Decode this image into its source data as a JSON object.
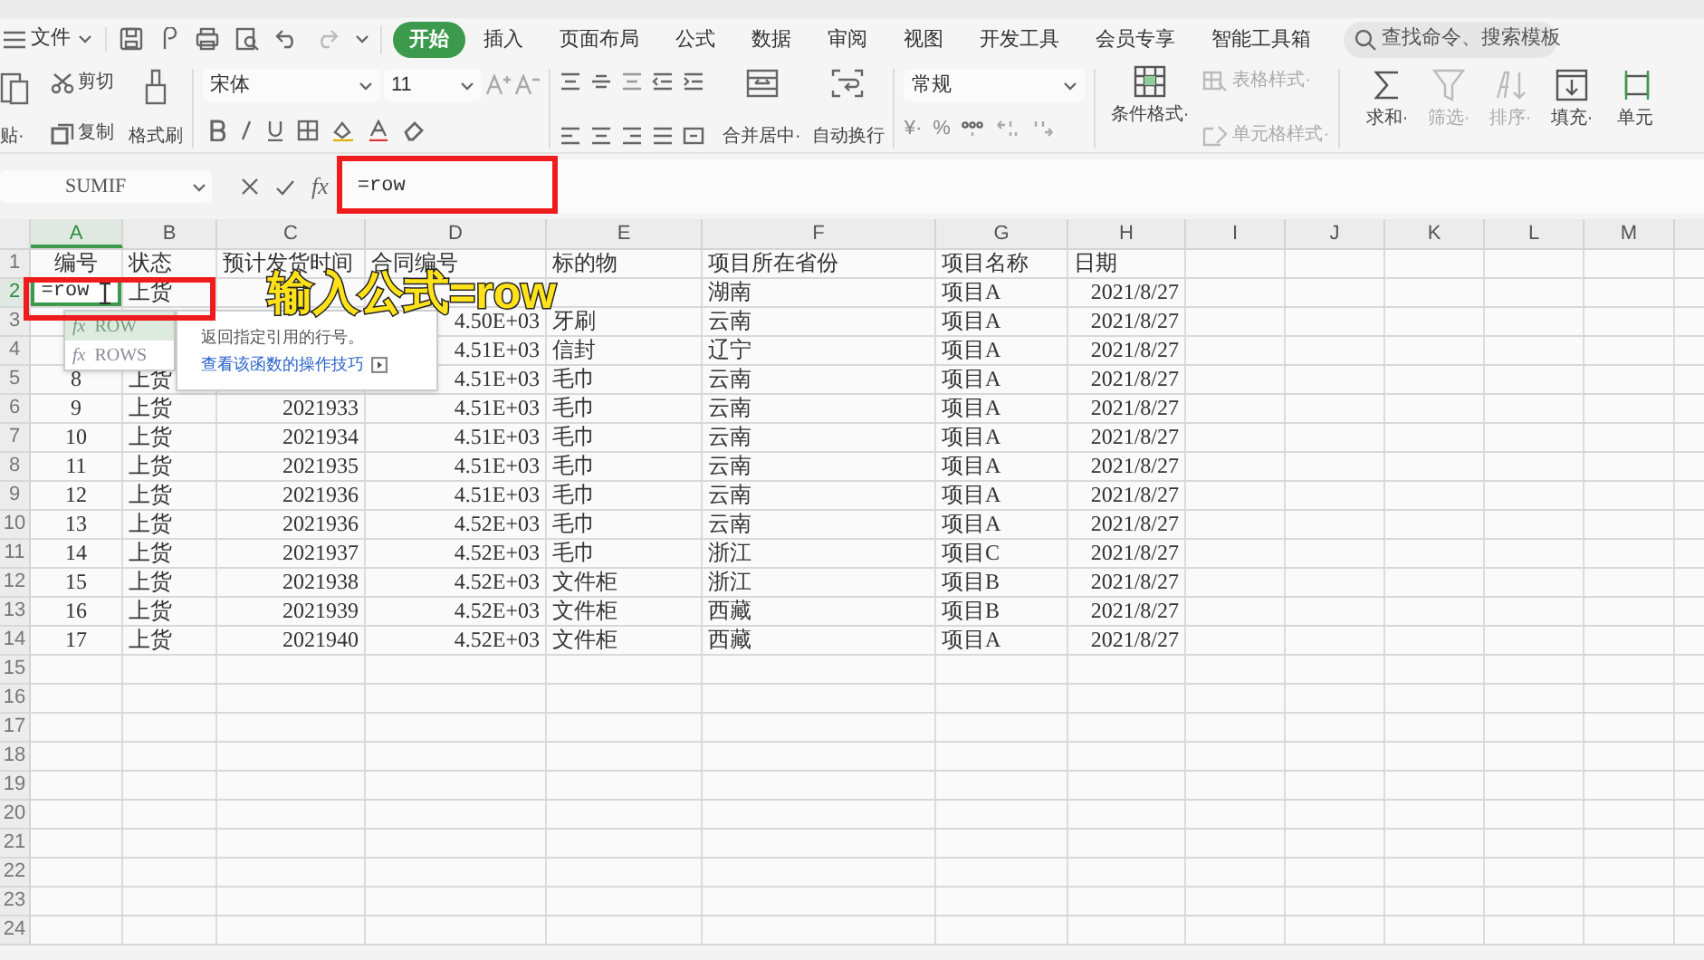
{
  "menu": {
    "file": "文件",
    "tabs": [
      {
        "label": "开始",
        "selected": true
      },
      {
        "label": "插入",
        "selected": false
      },
      {
        "label": "页面布局",
        "selected": false
      },
      {
        "label": "公式",
        "selected": false
      },
      {
        "label": "数据",
        "selected": false
      },
      {
        "label": "审阅",
        "selected": false
      },
      {
        "label": "视图",
        "selected": false
      },
      {
        "label": "开发工具",
        "selected": false
      },
      {
        "label": "会员专享",
        "selected": false
      },
      {
        "label": "智能工具箱",
        "selected": false
      }
    ],
    "search": {
      "placeholder": "查找命令、搜索模板"
    }
  },
  "ribbon": {
    "paste": "贴·",
    "cut": "剪切",
    "copy": "复制",
    "format_painter": "格式刷",
    "font": "宋体",
    "font_size": "11",
    "merge": "合并居中·",
    "wrap": "自动换行",
    "number_format": "常规",
    "currency": "¥·",
    "percent": "%",
    "styles": [
      {
        "kind": "conditional",
        "label": "条件格式·",
        "disabled": false
      },
      {
        "kind": "table-style",
        "label": "表格样式·",
        "disabled": true
      },
      {
        "kind": "cell-style",
        "label": "单元格样式·",
        "disabled": true
      }
    ],
    "editing": [
      {
        "kind": "sum",
        "label": "求和·",
        "disabled": false
      },
      {
        "kind": "filter",
        "label": "筛选·",
        "disabled": true
      },
      {
        "kind": "sort",
        "label": "排序·",
        "disabled": true
      },
      {
        "kind": "fill",
        "label": "填充·",
        "disabled": false
      },
      {
        "kind": "cell",
        "label": "单元",
        "disabled": false
      }
    ]
  },
  "formula_bar": {
    "name_box": "SUMIF",
    "fx": "fx",
    "value": "=row"
  },
  "sheet": {
    "columns": [
      {
        "letter": "A",
        "selected": true
      },
      {
        "letter": "B",
        "selected": false
      },
      {
        "letter": "C",
        "selected": false
      },
      {
        "letter": "D",
        "selected": false
      },
      {
        "letter": "E",
        "selected": false
      },
      {
        "letter": "F",
        "selected": false
      },
      {
        "letter": "G",
        "selected": false
      },
      {
        "letter": "H",
        "selected": false
      },
      {
        "letter": "I",
        "selected": false
      },
      {
        "letter": "J",
        "selected": false
      },
      {
        "letter": "K",
        "selected": false
      },
      {
        "letter": "L",
        "selected": false
      },
      {
        "letter": "M",
        "selected": false
      }
    ],
    "rows": [
      {
        "number": "1",
        "selected": false,
        "cells": {
          "A": "编号",
          "B": "状态",
          "C": "预计发货时间",
          "D": "合同编号",
          "E": "标的物",
          "F": "项目所在省份",
          "G": "项目名称",
          "H": "日期"
        }
      },
      {
        "number": "2",
        "selected": true,
        "editing_value": "=row",
        "cells": {
          "B": "上货",
          "F": "湖南",
          "G": "项目A",
          "H": "2021/8/27"
        }
      },
      {
        "number": "3",
        "selected": false,
        "cells": {
          "D": "4.50E+03",
          "E": "牙刷",
          "F": "云南",
          "G": "项目A",
          "H": "2021/8/27"
        }
      },
      {
        "number": "4",
        "selected": false,
        "cells": {
          "D": "4.51E+03",
          "E": "信封",
          "F": "辽宁",
          "G": "项目A",
          "H": "2021/8/27"
        }
      },
      {
        "number": "5",
        "selected": false,
        "cells": {
          "A": "8",
          "B": "上货",
          "D": "4.51E+03",
          "E": "毛巾",
          "F": "云南",
          "G": "项目A",
          "H": "2021/8/27"
        }
      },
      {
        "number": "6",
        "selected": false,
        "cells": {
          "A": "9",
          "B": "上货",
          "C": "2021933",
          "D": "4.51E+03",
          "E": "毛巾",
          "F": "云南",
          "G": "项目A",
          "H": "2021/8/27"
        }
      },
      {
        "number": "7",
        "selected": false,
        "cells": {
          "A": "10",
          "B": "上货",
          "C": "2021934",
          "D": "4.51E+03",
          "E": "毛巾",
          "F": "云南",
          "G": "项目A",
          "H": "2021/8/27"
        }
      },
      {
        "number": "8",
        "selected": false,
        "cells": {
          "A": "11",
          "B": "上货",
          "C": "2021935",
          "D": "4.51E+03",
          "E": "毛巾",
          "F": "云南",
          "G": "项目A",
          "H": "2021/8/27"
        }
      },
      {
        "number": "9",
        "selected": false,
        "cells": {
          "A": "12",
          "B": "上货",
          "C": "2021936",
          "D": "4.51E+03",
          "E": "毛巾",
          "F": "云南",
          "G": "项目A",
          "H": "2021/8/27"
        }
      },
      {
        "number": "10",
        "selected": false,
        "cells": {
          "A": "13",
          "B": "上货",
          "C": "2021936",
          "D": "4.52E+03",
          "E": "毛巾",
          "F": "云南",
          "G": "项目A",
          "H": "2021/8/27"
        }
      },
      {
        "number": "11",
        "selected": false,
        "cells": {
          "A": "14",
          "B": "上货",
          "C": "2021937",
          "D": "4.52E+03",
          "E": "毛巾",
          "F": "浙江",
          "G": "项目C",
          "H": "2021/8/27"
        }
      },
      {
        "number": "12",
        "selected": false,
        "cells": {
          "A": "15",
          "B": "上货",
          "C": "2021938",
          "D": "4.52E+03",
          "E": "文件柜",
          "F": "浙江",
          "G": "项目B",
          "H": "2021/8/27"
        }
      },
      {
        "number": "13",
        "selected": false,
        "cells": {
          "A": "16",
          "B": "上货",
          "C": "2021939",
          "D": "4.52E+03",
          "E": "文件柜",
          "F": "西藏",
          "G": "项目B",
          "H": "2021/8/27"
        }
      },
      {
        "number": "14",
        "selected": false,
        "cells": {
          "A": "17",
          "B": "上货",
          "C": "2021940",
          "D": "4.52E+03",
          "E": "文件柜",
          "F": "西藏",
          "G": "项目A",
          "H": "2021/8/27"
        }
      },
      {
        "number": "15",
        "selected": false,
        "cells": {}
      },
      {
        "number": "16",
        "selected": false,
        "cells": {}
      },
      {
        "number": "17",
        "selected": false,
        "cells": {}
      },
      {
        "number": "18",
        "selected": false,
        "cells": {}
      },
      {
        "number": "19",
        "selected": false,
        "cells": {}
      },
      {
        "number": "20",
        "selected": false,
        "cells": {}
      },
      {
        "number": "21",
        "selected": false,
        "cells": {}
      },
      {
        "number": "22",
        "selected": false,
        "cells": {}
      },
      {
        "number": "23",
        "selected": false,
        "cells": {}
      },
      {
        "number": "24",
        "selected": false,
        "cells": {}
      }
    ]
  },
  "autocomplete": {
    "items": [
      {
        "icon_text": "fx",
        "name": "ROW",
        "selected": true
      },
      {
        "icon_text": "fx",
        "name": "ROWS",
        "selected": false
      }
    ]
  },
  "tooltip": {
    "description": "返回指定引用的行号。",
    "link": "查看该函数的操作技巧"
  },
  "annotation": {
    "caption": "输入公式=row"
  }
}
